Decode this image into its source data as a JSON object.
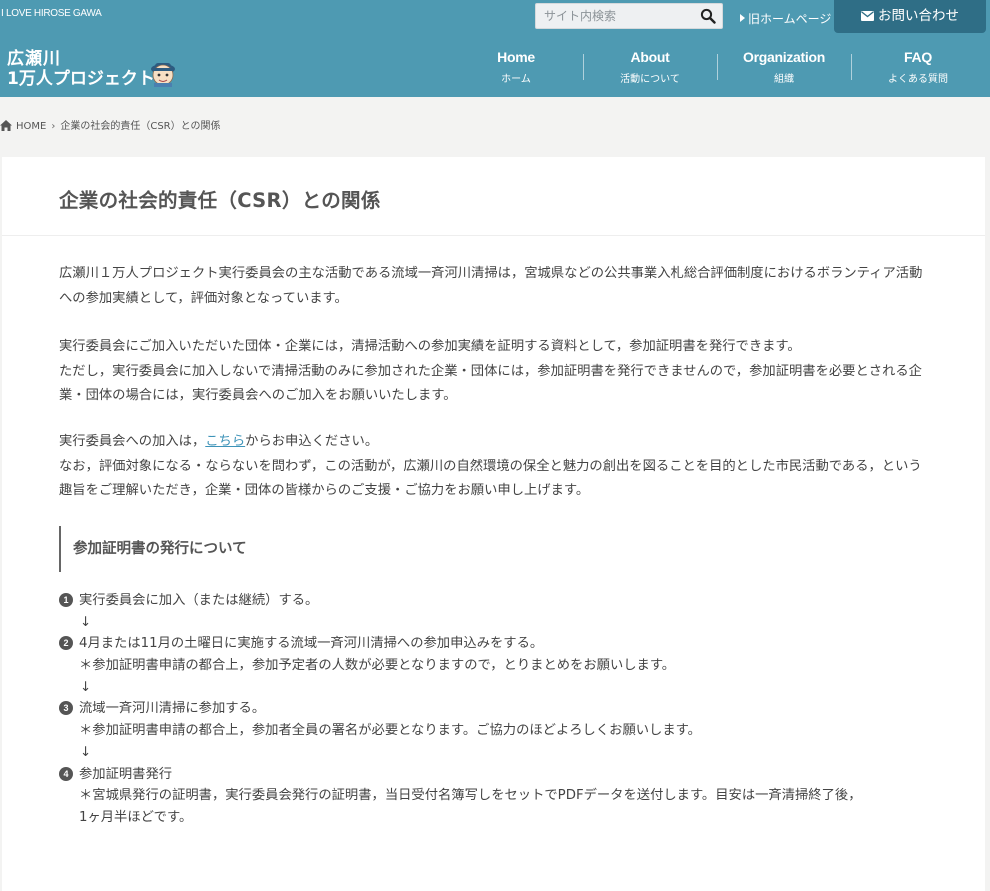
{
  "header": {
    "tagline": "I LOVE HIROSE GAWA",
    "search_placeholder": "サイト内検索",
    "old_home": "旧ホームページ",
    "contact": "お問い合わせ",
    "logo_line1": "広瀬川",
    "logo_line2": "1万人プロジェクト"
  },
  "nav": [
    {
      "en": "Home",
      "jp": "ホーム"
    },
    {
      "en": "About",
      "jp": "活動について"
    },
    {
      "en": "Organization",
      "jp": "組織"
    },
    {
      "en": "FAQ",
      "jp": "よくある質問"
    }
  ],
  "breadcrumb": {
    "home": "HOME",
    "current": "企業の社会的責任（CSR）との関係"
  },
  "page": {
    "title": "企業の社会的責任（CSR）との関係",
    "p1": "広瀬川１万人プロジェクト実行委員会の主な活動である流域一斉河川清掃は，宮城県などの公共事業入札総合評価制度におけるボランティア活動への参加実績として，評価対象となっています。",
    "p2a": "実行委員会にご加入いただいた団体・企業には，清掃活動への参加実績を証明する資料として，参加証明書を発行できます。",
    "p2b": "ただし，実行委員会に加入しないで清掃活動のみに参加された企業・団体には，参加証明書を発行できませんので，参加証明書を必要とされる企業・団体の場合には，実行委員会へのご加入をお願いいたします。",
    "p3_pre": "実行委員会への加入は，",
    "p3_link": "こちら",
    "p3_post": "からお申込ください。",
    "p3b": "なお，評価対象になる・ならないを問わず，この活動が，広瀬川の自然環境の保全と魅力の創出を図ることを目的とした市民活動である，という趣旨をご理解いただき，企業・団体の皆様からのご支援・ご協力をお願い申し上げます。",
    "subhead": "参加証明書の発行について",
    "arrow": "↓",
    "steps": [
      {
        "num": "1",
        "text": "実行委員会に加入（または継続）する。"
      },
      {
        "num": "2",
        "text": "4月または11月の土曜日に実施する流域一斉河川清掃への参加申込みをする。",
        "note": "＊参加証明書申請の都合上，参加予定者の人数が必要となりますので，とりまとめをお願いします。"
      },
      {
        "num": "3",
        "text": "流域一斉河川清掃に参加する。",
        "note": "＊参加証明書申請の都合上，参加者全員の署名が必要となります。ご協力のほどよろしくお願いします。"
      },
      {
        "num": "4",
        "text": "参加証明書発行",
        "note": "＊宮城県発行の証明書，実行委員会発行の証明書，当日受付名簿写しをセットでPDFデータを送付します。目安は一斉清掃終了後，",
        "note2": "1ヶ月半ほどです。"
      }
    ]
  }
}
